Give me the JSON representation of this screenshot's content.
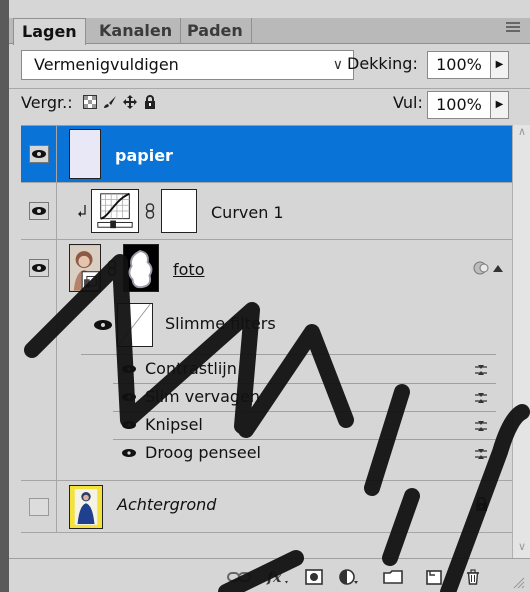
{
  "tabs": [
    {
      "label": "Lagen",
      "active": true
    },
    {
      "label": "Kanalen",
      "active": false
    },
    {
      "label": "Paden",
      "active": false
    }
  ],
  "blend_mode": {
    "selected": "Vermenigvuldigen"
  },
  "opacity": {
    "label": "Dekking:",
    "value": "100%"
  },
  "lock": {
    "label": "Vergr.:"
  },
  "fill": {
    "label": "Vul:",
    "value": "100%"
  },
  "layers": [
    {
      "name": "papier",
      "selected": true,
      "visible": true
    },
    {
      "name": "Curven 1",
      "selected": false,
      "visible": true
    },
    {
      "name": "foto",
      "selected": false,
      "visible": true
    },
    {
      "name": "Achtergrond",
      "selected": false,
      "visible": false
    }
  ],
  "smart_filters": {
    "label": "Slimme filters",
    "items": [
      "Contrastlijn",
      "Slim vervagen",
      "Knipsel",
      "Droog penseel"
    ]
  },
  "bottom_icons": [
    "link-icon",
    "fx-icon",
    "mask-icon",
    "adjustment-icon",
    "group-icon",
    "new-layer-icon",
    "trash-icon"
  ],
  "colors": {
    "selection": "#0a73d7",
    "panel": "#d6d6d6",
    "tabbar": "#b9b9b9",
    "watermark": "#111111"
  }
}
